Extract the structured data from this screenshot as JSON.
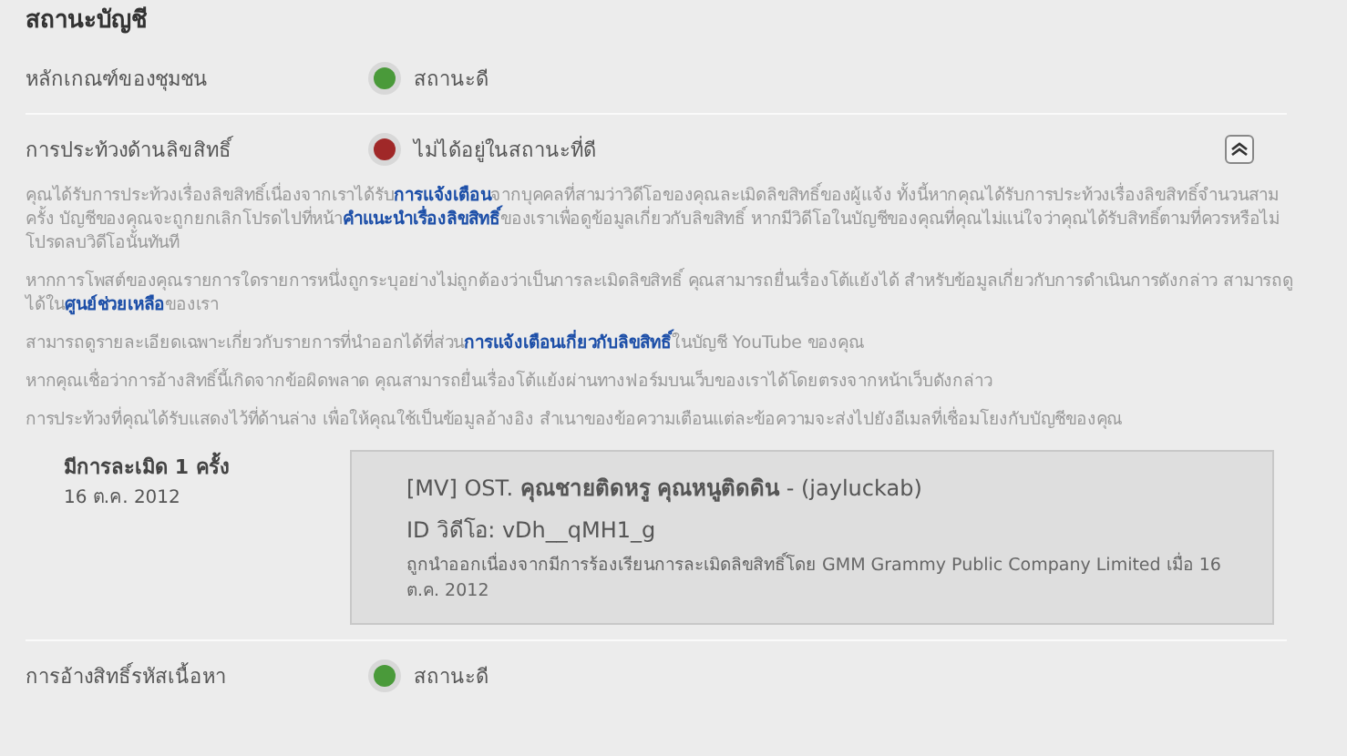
{
  "title": "สถานะบัญชี",
  "rows": [
    {
      "label": "หลักเกณฑ์ของชุมชน",
      "status": "สถานะดี",
      "color": "#4a9a3a"
    },
    {
      "label": "การประท้วงด้านลิขสิทธิ์",
      "status": "ไม่ได้อยู่ในสถานะที่ดี",
      "color": "#a02828",
      "expanded": true,
      "paragraphs": [
        [
          {
            "text": "คุณได้รับการประท้วงเรื่องลิขสิทธิ์เนื่องจากเราได้รับ"
          },
          {
            "link": "การแจ้งเตือน"
          },
          {
            "text": "จากบุคคลที่สามว่าวิดีโอของคุณละเมิดลิขสิทธิ์ของผู้แจ้ง ทั้งนี้หากคุณได้รับการประท้วงเรื่องลิขสิทธิ์จำนวนสามครั้ง บัญชีของคุณจะถูกยกเลิกโปรดไปที่หน้า"
          },
          {
            "link": "คำแนะนำเรื่องลิขสิทธิ์"
          },
          {
            "text": "ของเราเพื่อดูข้อมูลเกี่ยวกับลิขสิทธิ์ หากมีวิดีโอในบัญชีของคุณที่คุณไม่แน่ใจว่าคุณได้รับสิทธิ์ตามที่ควรหรือไม่ โปรดลบวิดีโอนั้นทันที"
          }
        ],
        [
          {
            "text": "หากการโพสต์ของคุณรายการใดรายการหนึ่งถูกระบุอย่างไม่ถูกต้องว่าเป็นการละเมิดลิขสิทธิ์ คุณสามารถยื่นเรื่องโต้แย้งได้ สำหรับข้อมูลเกี่ยวกับการดำเนินการดังกล่าว สามารถดูได้ใน"
          },
          {
            "link": "ศูนย์ช่วยเหลือ"
          },
          {
            "text": "ของเรา"
          }
        ],
        [
          {
            "text": "สามารถดูรายละเอียดเฉพาะเกี่ยวกับรายการที่นำออกได้ที่ส่วน"
          },
          {
            "link": "การแจ้งเตือนเกี่ยวกับลิขสิทธิ์"
          },
          {
            "text": "ในบัญชี YouTube ของคุณ"
          }
        ],
        [
          {
            "text": "หากคุณเชื่อว่าการอ้างสิทธิ์นี้เกิดจากข้อผิดพลาด คุณสามารถยื่นเรื่องโต้แย้งผ่านทางฟอร์มบนเว็บของเราได้โดยตรงจากหน้าเว็บดังกล่าว"
          }
        ],
        [
          {
            "text": "การประท้วงที่คุณได้รับแสดงไว้ที่ด้านล่าง เพื่อให้คุณใช้เป็นข้อมูลอ้างอิง สำเนาของข้อความเตือนแต่ละข้อความจะส่งไปยังอีเมลที่เชื่อมโยงกับบัญชีของคุณ"
          }
        ]
      ],
      "strikes": [
        {
          "count": "มีการละเมิด 1 ครั้ง",
          "date": "16 ต.ค. 2012",
          "video_title": "[MV] OST. **คุณชายติดหรู คุณหนูติดดิน** - (jayluckab)",
          "video_id": "ID วิดีโอ: vDh__qMH1_g",
          "reason": "ถูกนำออกเนื่องจากมีการร้องเรียนการละเมิดลิขสิทธิ์โดย GMM Grammy Public Company Limited เมื่อ 16 ต.ค. 2012"
        }
      ]
    },
    {
      "label": "การอ้างสิทธิ์รหัสเนื้อหา",
      "status": "สถานะดี",
      "color": "#4a9a3a"
    }
  ]
}
